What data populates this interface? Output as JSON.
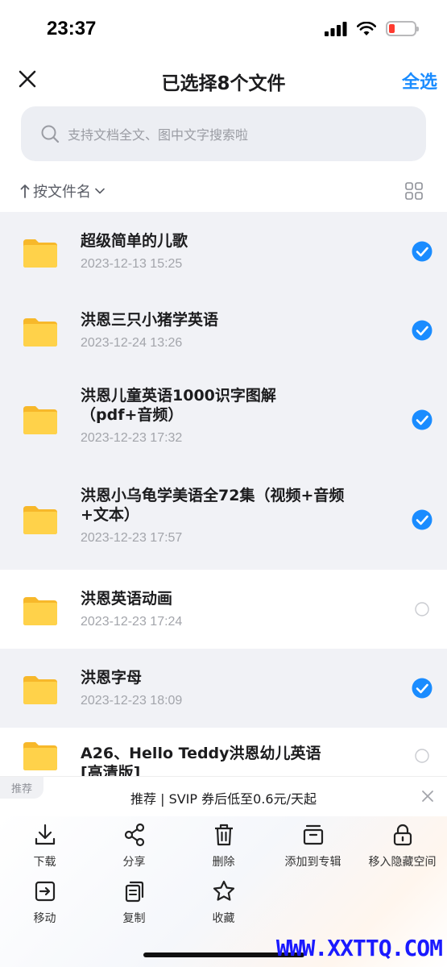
{
  "status": {
    "time": "23:37"
  },
  "nav": {
    "title": "已选择8个文件",
    "select_all": "全选"
  },
  "search": {
    "placeholder": "支持文档全文、图中文字搜索啦"
  },
  "sort": {
    "label": "按文件名"
  },
  "files": [
    {
      "title": "超级简单的儿歌",
      "date": "2023-12-13 15:25",
      "selected": true
    },
    {
      "title": "洪恩三只小猪学英语",
      "date": "2023-12-24 13:26",
      "selected": true
    },
    {
      "title": "洪恩儿童英语1000识字图解\n（pdf+音频）",
      "date": "2023-12-23 17:32",
      "selected": true
    },
    {
      "title": "洪恩小乌龟学美语全72集（视频+音频\n+文本）",
      "date": "2023-12-23 17:57",
      "selected": true
    },
    {
      "title": "洪恩英语动画",
      "date": "2023-12-23 17:24",
      "selected": false
    },
    {
      "title": "洪恩字母",
      "date": "2023-12-23 18:09",
      "selected": true
    },
    {
      "title": "A26、Hello Teddy洪恩幼儿英语\n[高清版]",
      "date": "",
      "selected": false
    }
  ],
  "promo": {
    "tag": "推荐",
    "text": "推荐 | SVIP 券后低至0.6元/天起"
  },
  "actions": [
    {
      "label": "下载",
      "icon": "download-icon"
    },
    {
      "label": "分享",
      "icon": "share-icon"
    },
    {
      "label": "删除",
      "icon": "trash-icon"
    },
    {
      "label": "添加到专辑",
      "icon": "album-icon"
    },
    {
      "label": "移入隐藏空间",
      "icon": "lock-icon"
    },
    {
      "label": "移动",
      "icon": "move-icon"
    },
    {
      "label": "复制",
      "icon": "copy-icon"
    },
    {
      "label": "收藏",
      "icon": "star-icon"
    }
  ],
  "watermark": "WWW.XXTTQ.COM",
  "colors": {
    "accent": "#1a8cff",
    "folder": "#ffc93c",
    "battery_low": "#ff3b30"
  }
}
